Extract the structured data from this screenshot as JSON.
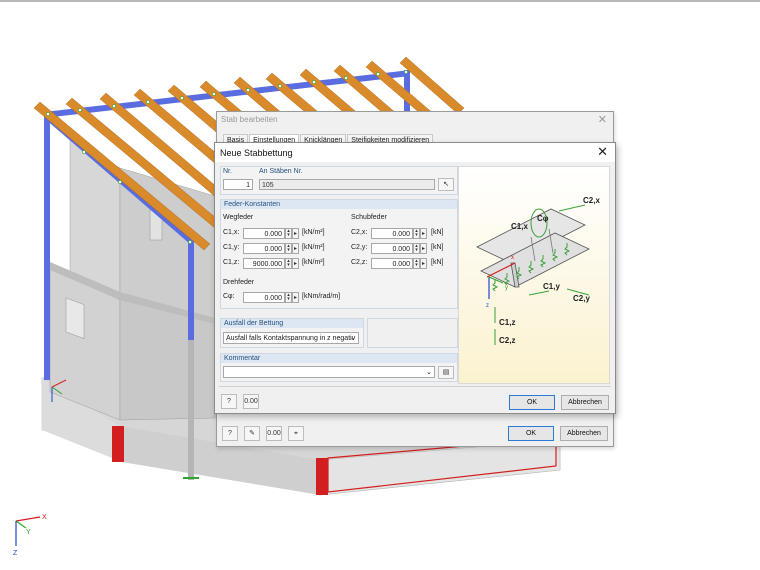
{
  "colors": {
    "beam_orange": "#d98a2b",
    "beam_blue": "#5a6de0",
    "support_red": "#d21e1e",
    "dialog_bg": "#f0f0f0",
    "group_header": "#dde7f4",
    "image_bg": "#fbf2cf",
    "spring_green": "#3aa13a"
  },
  "back_dialog": {
    "title": "Stab bearbeiten",
    "tabs": [
      "Basis",
      "Einstellungen",
      "Knicklängen",
      "Steifigkeiten modifizieren"
    ],
    "ok_label": "OK",
    "cancel_label": "Abbrechen",
    "footer_icons": [
      "help-icon",
      "edit-icon",
      "units-icon",
      "select-icon"
    ]
  },
  "dialog": {
    "title": "Neue Stabbettung",
    "nr_label": "Nr.",
    "nr_value": "1",
    "members_label": "An Stäben Nr.",
    "members_value": "105",
    "constants_header": "Feder-Konstanten",
    "translational_label": "Wegfeder",
    "shear_label": "Schubfeder",
    "translational": [
      {
        "label": "C1,x:",
        "value": "0.000",
        "unit": "[kN/m²]"
      },
      {
        "label": "C1,y:",
        "value": "0.000",
        "unit": "[kN/m²]"
      },
      {
        "label": "C1,z:",
        "value": "9000.000",
        "unit": "[kN/m²]"
      }
    ],
    "shear": [
      {
        "label": "C2,x:",
        "value": "0.000",
        "unit": "[kN]"
      },
      {
        "label": "C2,y:",
        "value": "0.000",
        "unit": "[kN]"
      },
      {
        "label": "C2,z:",
        "value": "0.000",
        "unit": "[kN]"
      }
    ],
    "rotational_label": "Drehfeder",
    "rotational": {
      "label": "Cφ:",
      "value": "0.000",
      "unit": "[kNm/rad/m]"
    },
    "failure_header": "Ausfall der Bettung",
    "failure_value": "Ausfall falls Kontaktspannung in z negativ",
    "comment_header": "Kommentar",
    "comment_value": "",
    "ok_label": "OK",
    "cancel_label": "Abbrechen",
    "footer_icons": [
      "help-icon",
      "units-icon"
    ]
  },
  "diagram_labels": {
    "c_phi": "Cφ",
    "c1x": "C1,x",
    "c2x": "C2,x",
    "c1y": "C1,y",
    "c2y": "C2,y",
    "c1z": "C1,z",
    "c2z": "C2,z",
    "x": "x",
    "y": "y",
    "z": "z"
  },
  "axes": {
    "x": "X",
    "y": "Y",
    "z": "Z"
  }
}
